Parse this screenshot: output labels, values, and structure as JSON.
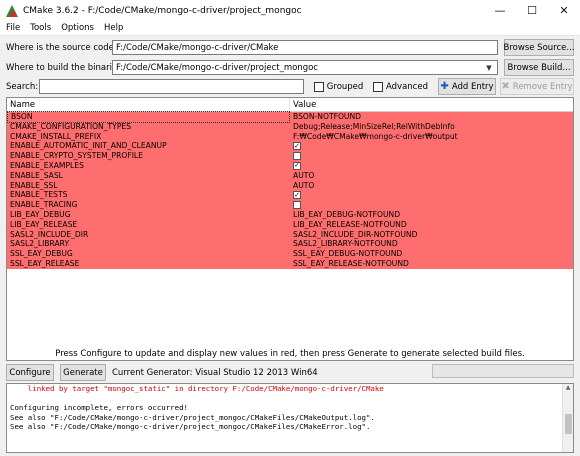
{
  "window": {
    "title": "CMake 3.6.2 - F:/Code/CMake/mongo-c-driver/project_mongoc",
    "minimize": "—",
    "maximize": "☐",
    "close": "✕"
  },
  "menu": [
    "File",
    "Tools",
    "Options",
    "Help"
  ],
  "source": {
    "label": "Where is the source code:",
    "value": "F:/Code/CMake/mongo-c-driver/CMake",
    "button": "Browse Source..."
  },
  "build": {
    "label": "Where to build the binaries:",
    "value": "F:/Code/CMake/mongo-c-driver/project_mongoc",
    "button": "Browse Build..."
  },
  "search": {
    "label": "Search:",
    "value": "",
    "grouped": "Grouped",
    "advanced": "Advanced",
    "add_entry": "Add Entry",
    "remove_entry": "Remove Entry"
  },
  "table": {
    "headers": [
      "Name",
      "Value"
    ],
    "rows": [
      {
        "name": "BSON",
        "type": "text",
        "value": "BSON-NOTFOUND"
      },
      {
        "name": "CMAKE_CONFIGURATION_TYPES",
        "type": "text",
        "value": "Debug;Release;MinSizeRel;RelWithDebInfo"
      },
      {
        "name": "CMAKE_INSTALL_PREFIX",
        "type": "text",
        "value": "F:₩Code₩CMake₩mongo-c-driver₩output"
      },
      {
        "name": "ENABLE_AUTOMATIC_INIT_AND_CLEANUP",
        "type": "check",
        "checked": true
      },
      {
        "name": "ENABLE_CRYPTO_SYSTEM_PROFILE",
        "type": "check",
        "checked": false
      },
      {
        "name": "ENABLE_EXAMPLES",
        "type": "check",
        "checked": true
      },
      {
        "name": "ENABLE_SASL",
        "type": "text",
        "value": "AUTO"
      },
      {
        "name": "ENABLE_SSL",
        "type": "text",
        "value": "AUTO"
      },
      {
        "name": "ENABLE_TESTS",
        "type": "check",
        "checked": true
      },
      {
        "name": "ENABLE_TRACING",
        "type": "check",
        "checked": false
      },
      {
        "name": "LIB_EAY_DEBUG",
        "type": "text",
        "value": "LIB_EAY_DEBUG-NOTFOUND"
      },
      {
        "name": "LIB_EAY_RELEASE",
        "type": "text",
        "value": "LIB_EAY_RELEASE-NOTFOUND"
      },
      {
        "name": "SASL2_INCLUDE_DIR",
        "type": "text",
        "value": "SASL2_INCLUDE_DIR-NOTFOUND"
      },
      {
        "name": "SASL2_LIBRARY",
        "type": "text",
        "value": "SASL2_LIBRARY-NOTFOUND"
      },
      {
        "name": "SSL_EAY_DEBUG",
        "type": "text",
        "value": "SSL_EAY_DEBUG-NOTFOUND"
      },
      {
        "name": "SSL_EAY_RELEASE",
        "type": "text",
        "value": "SSL_EAY_RELEASE-NOTFOUND"
      }
    ],
    "highlight_color": "#ff6e6e"
  },
  "hint": "Press Configure to update and display new values in red, then press Generate to generate selected build files.",
  "actions": {
    "configure": "Configure",
    "generate": "Generate",
    "current_generator": "Current Generator: Visual Studio 12 2013 Win64"
  },
  "output": [
    {
      "text": "    linked by target \"mongoc_static\" in directory F:/Code/CMake/mongo-c-driver/CMake",
      "color": "red"
    },
    {
      "text": "",
      "color": "black"
    },
    {
      "text": "Configuring incomplete, errors occurred!",
      "color": "black"
    },
    {
      "text": "See also \"F:/Code/CMake/mongo-c-driver/project_mongoc/CMakeFiles/CMakeOutput.log\".",
      "color": "black"
    },
    {
      "text": "See also \"F:/Code/CMake/mongo-c-driver/project_mongoc/CMakeFiles/CMakeError.log\".",
      "color": "black"
    }
  ]
}
